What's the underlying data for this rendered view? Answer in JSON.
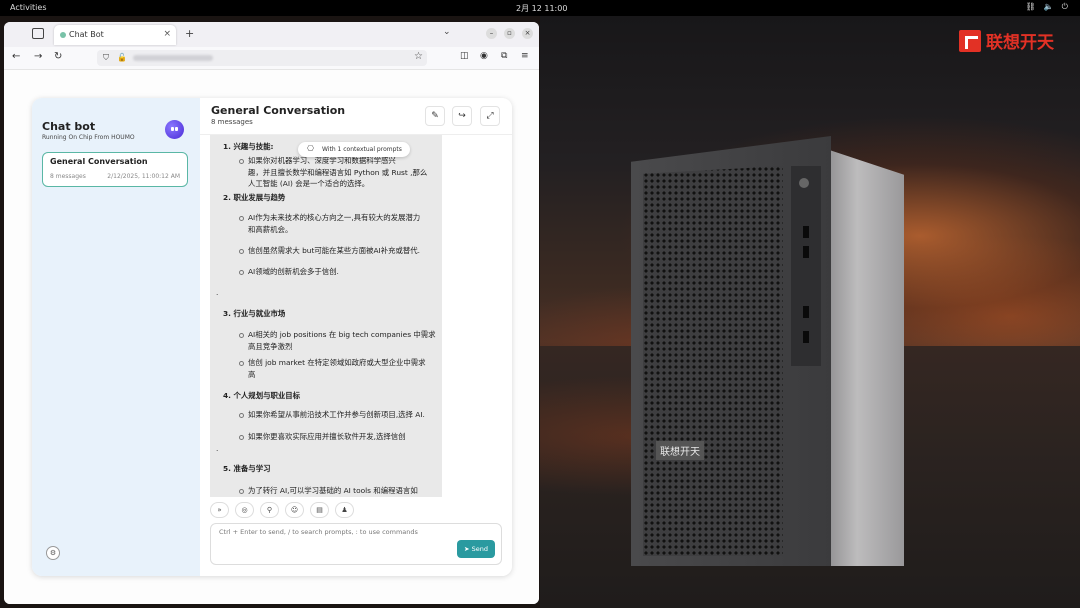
{
  "topbar": {
    "activities": "Activities",
    "clock": "2月 12  11:00"
  },
  "wallpaper": {
    "logo_text": "联想开天",
    "case_badge": "联想开天"
  },
  "browser": {
    "tab_title": "Chat Bot",
    "tab_close": "×",
    "new_tab": "+",
    "tab_list": "⌄",
    "url_blurred": true
  },
  "app": {
    "sidebar": {
      "title": "Chat bot",
      "subtitle": "Running On Chip From HOUMO",
      "conversations": [
        {
          "name": "General Conversation",
          "meta": "8 messages",
          "date": "2/12/2025, 11:00:12 AM"
        }
      ]
    },
    "header": {
      "title": "General Conversation",
      "subtitle": "8 messages"
    },
    "context_chip": "With 1 contextual prompts",
    "message_lines": [
      {
        "text": "1. 兴趣与技能:",
        "bold": true
      },
      {
        "text": "如果你对机器学习、深度学习和数据科学感兴",
        "bullet": true
      },
      {
        "text": "趣，并且擅长数学和编程语言如 Python 或 Rust ,那么"
      },
      {
        "text": "人工智能 (AI) 会是一个适合的选择。"
      },
      {
        "text": "2. 职业发展与趋势",
        "bold": true
      },
      {
        "text": "AI作为未来技术的核心方向之一,具有较大的发展潜力",
        "bullet": true
      },
      {
        "text": "和高薪机会。"
      },
      {
        "text": "信创虽然需求大 but可能在某些方面被AI补充或替代.",
        "bullet": true
      },
      {
        "text": "AI领域的创新机会多于信创.",
        "bullet": true
      },
      {
        "text": "."
      },
      {
        "text": "3. 行业与就业市场",
        "bold": true
      },
      {
        "text": "AI相关的 job positions 在 big tech companies 中需求",
        "bullet": true
      },
      {
        "text": "高且竞争激烈"
      },
      {
        "text": "信创 job market 在特定领域如政府或大型企业中需求",
        "bullet": true
      },
      {
        "text": "高"
      },
      {
        "text": "4. 个人规划与职业目标",
        "bold": true
      },
      {
        "text": "如果你希望从事前沿技术工作并参与创新项目,选择 AI.",
        "bullet": true
      },
      {
        "text": "如果你更喜欢实际应用并擅长软件开发,选择信创",
        "bullet": true
      },
      {
        "text": "."
      },
      {
        "text": "5. 准备与学习",
        "bold": true
      },
      {
        "text": "为了转行 AI,可以学习基础的 AI tools 和编程语言如",
        "bullet": true
      }
    ],
    "composer": {
      "placeholder": "Ctrl + Enter to send, / to search prompts, : to use commands",
      "send_label": "Send"
    }
  }
}
